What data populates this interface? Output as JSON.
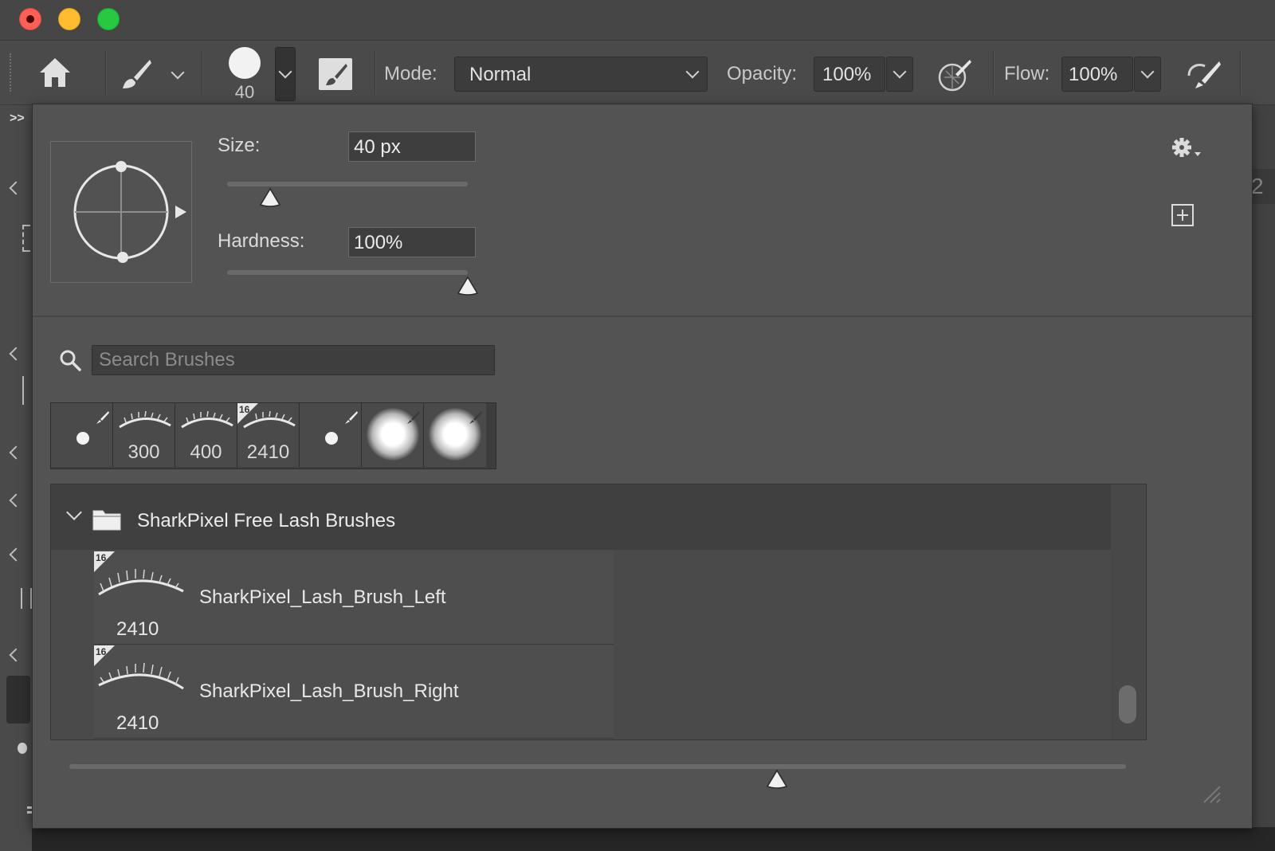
{
  "options_bar": {
    "brush_size_value": "40",
    "mode_label": "Mode:",
    "mode_value": "Normal",
    "opacity_label": "Opacity:",
    "opacity_value": "100%",
    "flow_label": "Flow:",
    "flow_value": "100%"
  },
  "left_toolbar": {
    "expand_label": ">>"
  },
  "right_strip": {
    "partial_text": "2"
  },
  "brush_panel": {
    "size_label": "Size:",
    "size_value": "40 px",
    "size_fraction": 0.18,
    "hardness_label": "Hardness:",
    "hardness_value": "100%",
    "hardness_fraction": 1.0,
    "search_placeholder": "Search Brushes",
    "recent_brushes": [
      {
        "type": "hard-dot",
        "number": ""
      },
      {
        "type": "lash",
        "number": "300"
      },
      {
        "type": "lash",
        "number": "400"
      },
      {
        "type": "lash-16",
        "number": "2410",
        "badge": "16"
      },
      {
        "type": "hard-dot",
        "number": ""
      },
      {
        "type": "soft",
        "number": ""
      },
      {
        "type": "soft",
        "number": ""
      }
    ],
    "group_name": "SharkPixel Free Lash Brushes",
    "brushes": [
      {
        "name": "SharkPixel_Lash_Brush_Left",
        "number": "2410",
        "badge": "16"
      },
      {
        "name": "SharkPixel_Lash_Brush_Right",
        "number": "2410",
        "badge": "16"
      }
    ],
    "preview_size_fraction": 0.67
  }
}
